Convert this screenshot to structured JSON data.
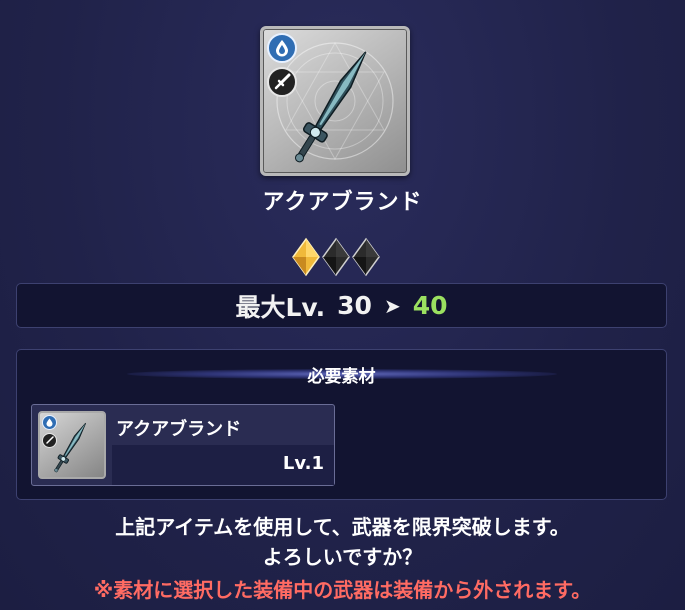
{
  "weapon": {
    "name": "アクアブランド",
    "element_icon": "water-drop-icon",
    "type_icon": "sword-icon"
  },
  "limit_break": {
    "gems_filled": 1,
    "gems_total": 3,
    "gem_colors": {
      "filled": "#f0b93a",
      "empty": "#2b2b2b"
    }
  },
  "level": {
    "label": "最大Lv.",
    "current": "30",
    "arrow": "➤",
    "next": "40",
    "next_color": "#9be060"
  },
  "materials": {
    "title": "必要素材",
    "items": [
      {
        "name": "アクアブランド",
        "level": "Lv.1"
      }
    ]
  },
  "confirm": {
    "line1": "上記アイテムを使用して、武器を限界突破します。",
    "line2": "よろしいですか？"
  },
  "warning": {
    "text": "※素材に選択した装備中の武器は装備から外されます。",
    "color": "#ff6b63"
  }
}
